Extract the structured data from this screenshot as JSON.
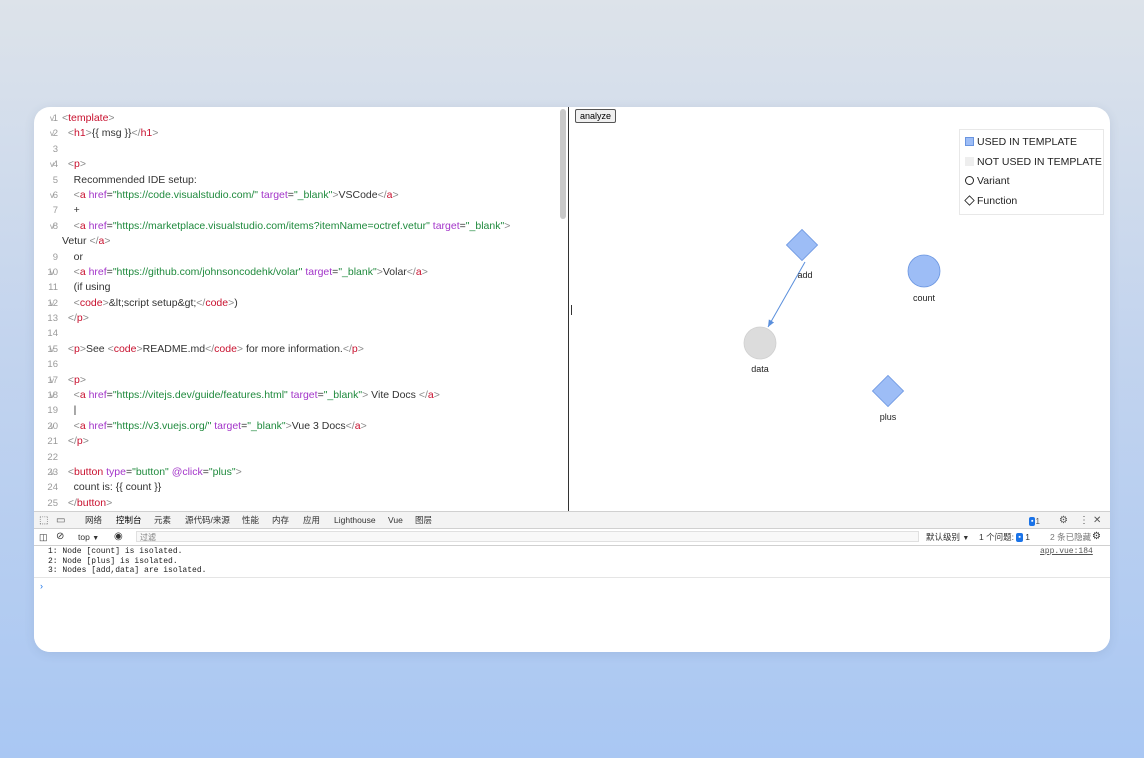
{
  "editor": {
    "lines": [
      {
        "n": "1",
        "fold": true,
        "html": "<span class='p'>&lt;</span><span class='t'>template</span><span class='p'>&gt;</span>"
      },
      {
        "n": "2",
        "fold": true,
        "html": "  <span class='p'>&lt;</span><span class='t'>h1</span><span class='p'>&gt;</span><span class='txt'>{{ msg }}</span><span class='p'>&lt;/</span><span class='t'>h1</span><span class='p'>&gt;</span>"
      },
      {
        "n": "3",
        "fold": false,
        "html": ""
      },
      {
        "n": "4",
        "fold": true,
        "html": "  <span class='p'>&lt;</span><span class='t'>p</span><span class='p'>&gt;</span>"
      },
      {
        "n": "5",
        "fold": false,
        "html": "    <span class='txt'>Recommended IDE setup:</span>"
      },
      {
        "n": "6",
        "fold": true,
        "html": "    <span class='p'>&lt;</span><span class='t'>a</span> <span class='a'>href</span>=<span class='s'>\"https://code.visualstudio.com/\"</span> <span class='a'>target</span>=<span class='s'>\"_blank\"</span><span class='p'>&gt;</span><span class='txt'>VSCode</span><span class='p'>&lt;/</span><span class='t'>a</span><span class='p'>&gt;</span>"
      },
      {
        "n": "7",
        "fold": false,
        "html": "    <span class='txt'>+</span>"
      },
      {
        "n": "8",
        "fold": true,
        "html": "    <span class='p'>&lt;</span><span class='t'>a</span> <span class='a'>href</span>=<span class='s'>\"https://marketplace.visualstudio.com/items?itemName=octref.vetur\"</span> <span class='a'>target</span>=<span class='s'>\"_blank\"</span><span class='p'>&gt;</span>"
      },
      {
        "n": "",
        "fold": false,
        "wrap": true,
        "html": "<span class='txt'>Vetur </span><span class='p'>&lt;/</span><span class='t'>a</span><span class='p'>&gt;</span>"
      },
      {
        "n": "9",
        "fold": false,
        "html": "    <span class='txt'>or</span>"
      },
      {
        "n": "10",
        "fold": true,
        "html": "    <span class='p'>&lt;</span><span class='t'>a</span> <span class='a'>href</span>=<span class='s'>\"https://github.com/johnsoncodehk/volar\"</span> <span class='a'>target</span>=<span class='s'>\"_blank\"</span><span class='p'>&gt;</span><span class='txt'>Volar</span><span class='p'>&lt;/</span><span class='t'>a</span><span class='p'>&gt;</span>"
      },
      {
        "n": "11",
        "fold": false,
        "html": "    <span class='txt'>(if using</span>"
      },
      {
        "n": "12",
        "fold": true,
        "html": "    <span class='p'>&lt;</span><span class='t'>code</span><span class='p'>&gt;</span><span class='txt'>&amp;lt;script setup&amp;gt;</span><span class='p'>&lt;/</span><span class='t'>code</span><span class='p'>&gt;</span><span class='txt'>)</span>"
      },
      {
        "n": "13",
        "fold": false,
        "html": "  <span class='p'>&lt;/</span><span class='t'>p</span><span class='p'>&gt;</span>"
      },
      {
        "n": "14",
        "fold": false,
        "html": ""
      },
      {
        "n": "15",
        "fold": true,
        "html": "  <span class='p'>&lt;</span><span class='t'>p</span><span class='p'>&gt;</span><span class='txt'>See </span><span class='p'>&lt;</span><span class='t'>code</span><span class='p'>&gt;</span><span class='txt'>README.md</span><span class='p'>&lt;/</span><span class='t'>code</span><span class='p'>&gt;</span><span class='txt'> for more information.</span><span class='p'>&lt;/</span><span class='t'>p</span><span class='p'>&gt;</span>"
      },
      {
        "n": "16",
        "fold": false,
        "html": ""
      },
      {
        "n": "17",
        "fold": true,
        "html": "  <span class='p'>&lt;</span><span class='t'>p</span><span class='p'>&gt;</span>"
      },
      {
        "n": "18",
        "fold": true,
        "html": "    <span class='p'>&lt;</span><span class='t'>a</span> <span class='a'>href</span>=<span class='s'>\"https://vitejs.dev/guide/features.html\"</span> <span class='a'>target</span>=<span class='s'>\"_blank\"</span><span class='p'>&gt;</span><span class='txt'> Vite Docs </span><span class='p'>&lt;/</span><span class='t'>a</span><span class='p'>&gt;</span>"
      },
      {
        "n": "19",
        "fold": false,
        "html": "    <span class='txt'>|</span>"
      },
      {
        "n": "20",
        "fold": true,
        "html": "    <span class='p'>&lt;</span><span class='t'>a</span> <span class='a'>href</span>=<span class='s'>\"https://v3.vuejs.org/\"</span> <span class='a'>target</span>=<span class='s'>\"_blank\"</span><span class='p'>&gt;</span><span class='txt'>Vue 3 Docs</span><span class='p'>&lt;/</span><span class='t'>a</span><span class='p'>&gt;</span>"
      },
      {
        "n": "21",
        "fold": false,
        "html": "  <span class='p'>&lt;/</span><span class='t'>p</span><span class='p'>&gt;</span>"
      },
      {
        "n": "22",
        "fold": false,
        "html": ""
      },
      {
        "n": "23",
        "fold": true,
        "html": "  <span class='p'>&lt;</span><span class='t'>button</span> <span class='a'>type</span>=<span class='s'>\"button\"</span> <span class='a'>@click</span>=<span class='s'>\"plus\"</span><span class='p'>&gt;</span>"
      },
      {
        "n": "24",
        "fold": false,
        "html": "    <span class='txt'>count is: {{ count }}</span>"
      },
      {
        "n": "25",
        "fold": false,
        "html": "  <span class='p'>&lt;/</span><span class='t'>button</span><span class='p'>&gt;</span>"
      }
    ]
  },
  "graph": {
    "analyze_label": "analyze",
    "legend": {
      "used": "USED IN TEMPLATE",
      "unused": "NOT USED IN TEMPLATE",
      "variant": "Variant",
      "function": "Function"
    },
    "nodes": {
      "add": "add",
      "count": "count",
      "data": "data",
      "plus": "plus"
    },
    "colors": {
      "used": "#9dbdf6",
      "used_stroke": "#6a95e0",
      "unused": "#dcdcdc",
      "edge": "#5a8fdc"
    }
  },
  "devtools": {
    "tabs": [
      "网络",
      "控制台",
      "元素",
      "源代码/来源",
      "性能",
      "内存",
      "应用",
      "Lighthouse",
      "Vue",
      "图层"
    ],
    "active_tab": "控制台",
    "issues_badge": "1",
    "context": "top",
    "filter_placeholder": "过滤",
    "levels": "默认级别",
    "issues_label": "1 个问题:",
    "issues_count": "1",
    "hidden": "2 条已隐藏",
    "messages": [
      "1: Node [count] is isolated.",
      "2: Node [plus] is isolated.",
      "3: Nodes [add,data] are isolated."
    ],
    "source": "app.vue:184",
    "prompt": "›"
  }
}
